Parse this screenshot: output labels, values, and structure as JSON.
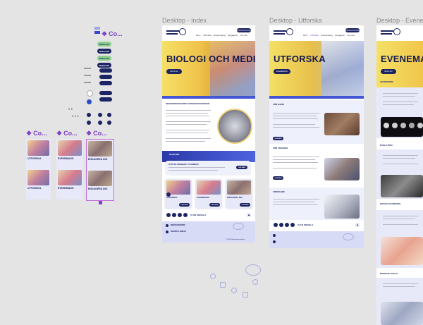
{
  "frames": {
    "index": {
      "label": "Desktop - Index"
    },
    "utforska": {
      "label": "Desktop - Utforska"
    },
    "evenemang": {
      "label": "Desktop - Evene"
    }
  },
  "components": {
    "top_label": "Co...",
    "card_labels": [
      "Co...",
      "Co...",
      "Co..."
    ]
  },
  "buttons_panel": {
    "labels": [
      "BOKA NU",
      "BOKA NU",
      "BOKA NU",
      "BOKA NU"
    ]
  },
  "component_cards": {
    "col1": [
      "UTFORSKA",
      "UTFORSKA"
    ],
    "col2": [
      "EVENEMANG",
      "EVENEMANG"
    ],
    "col3": [
      "ENGAGERA DIG",
      "ENGAGERA DIG"
    ]
  },
  "index_page": {
    "nav_cta": "KONTAKTA OSS",
    "nav_links": [
      "Hem",
      "Utforska",
      "Evenemang",
      "Engagera",
      "Om oss"
    ],
    "hero_title": "BIOLOGI OCH MEDICIN",
    "hero_button": "BOKA NU",
    "intro_heading": "SEVENOBSERVATORIET VETENSKAPSCENTRUM",
    "news_tag": "NYHETER",
    "news_heading": "UTSTÄLLNINGAR: FLAMMAN",
    "news_button": "LÄS MER",
    "cards": [
      "UTFORSKA",
      "EVENEMANG",
      "ENGAGERA DIG"
    ],
    "card_button": "LÄS MER",
    "social_label": "VI ÄR SOCIALA",
    "footer_sections": [
      "BESÖKSADRESS",
      "ÖPPETTIDER",
      "SNABBA LÄNKAR"
    ],
    "footer_copy": "© 2024 Vetenskapscentrum"
  },
  "utforska_page": {
    "nav_cta": "KONTAKTA OSS",
    "hero_title": "UTFORSKA",
    "hero_button": "EVENEMANG",
    "sections": [
      "FÖR BARN",
      "FÖR UNGDOM",
      "FORSKARE"
    ],
    "section_button": "LÄS MER",
    "social_label": "VI ÄR SOCIALA"
  },
  "evenemang_page": {
    "hero_title": "EVENEMANG",
    "hero_button": "BOKA NU",
    "sections": [
      "ASTRONOMI",
      "EVOLUTION",
      "BIOLOGI OCH MEDICIN",
      "ROBOTIK OCH AI"
    ]
  },
  "colors": {
    "navy": "#1c2463",
    "accent_purple": "#7b3fc7",
    "hero_yellow": "#f0c34a",
    "footer_lavender": "#d8dbf5",
    "canvas": "#e4e4e4"
  }
}
